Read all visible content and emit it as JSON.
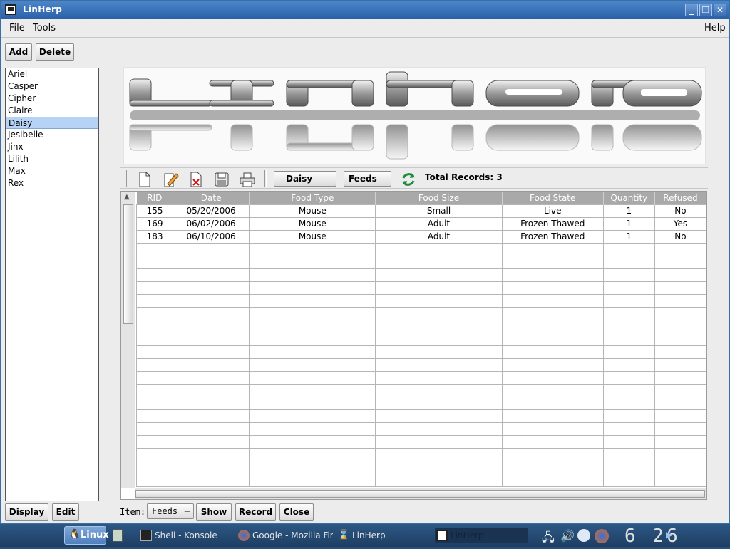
{
  "window": {
    "title": "LinHerp"
  },
  "menu": {
    "file": "File",
    "tools": "Tools",
    "help": "Help"
  },
  "top_buttons": {
    "add": "Add",
    "delete": "Delete"
  },
  "pets": [
    "Ariel",
    "Casper",
    "Cipher",
    "Claire",
    "Daisy",
    "Jesibelle",
    "Jinx",
    "Lilith",
    "Max",
    "Rex"
  ],
  "selected_pet": "Daisy",
  "toolbar": {
    "icons": [
      "new-icon",
      "edit-icon",
      "delete-icon",
      "save-icon",
      "print-icon"
    ],
    "pet_combo": "Daisy",
    "type_combo": "Feeds",
    "total_records": "Total Records: 3"
  },
  "table": {
    "columns": [
      "RID",
      "Date",
      "Food Type",
      "Food Size",
      "Food State",
      "Quantity",
      "Refused"
    ],
    "rows": [
      [
        "155",
        "05/20/2006",
        "Mouse",
        "Small",
        "Live",
        "1",
        "No"
      ],
      [
        "169",
        "06/02/2006",
        "Mouse",
        "Adult",
        "Frozen Thawed",
        "1",
        "Yes"
      ],
      [
        "183",
        "06/10/2006",
        "Mouse",
        "Adult",
        "Frozen Thawed",
        "1",
        "No"
      ]
    ],
    "empty_rows": 19
  },
  "bottom": {
    "display": "Display",
    "edit": "Edit",
    "item_label": "Item:",
    "item_combo": "Feeds",
    "show": "Show",
    "record": "Record",
    "close": "Close"
  },
  "taskbar": {
    "start": "Linux",
    "tasks": [
      "Shell - Konsole",
      "Google - Mozilla Firef",
      "LinHerp",
      "LinHerp"
    ],
    "clock": "6 26"
  }
}
